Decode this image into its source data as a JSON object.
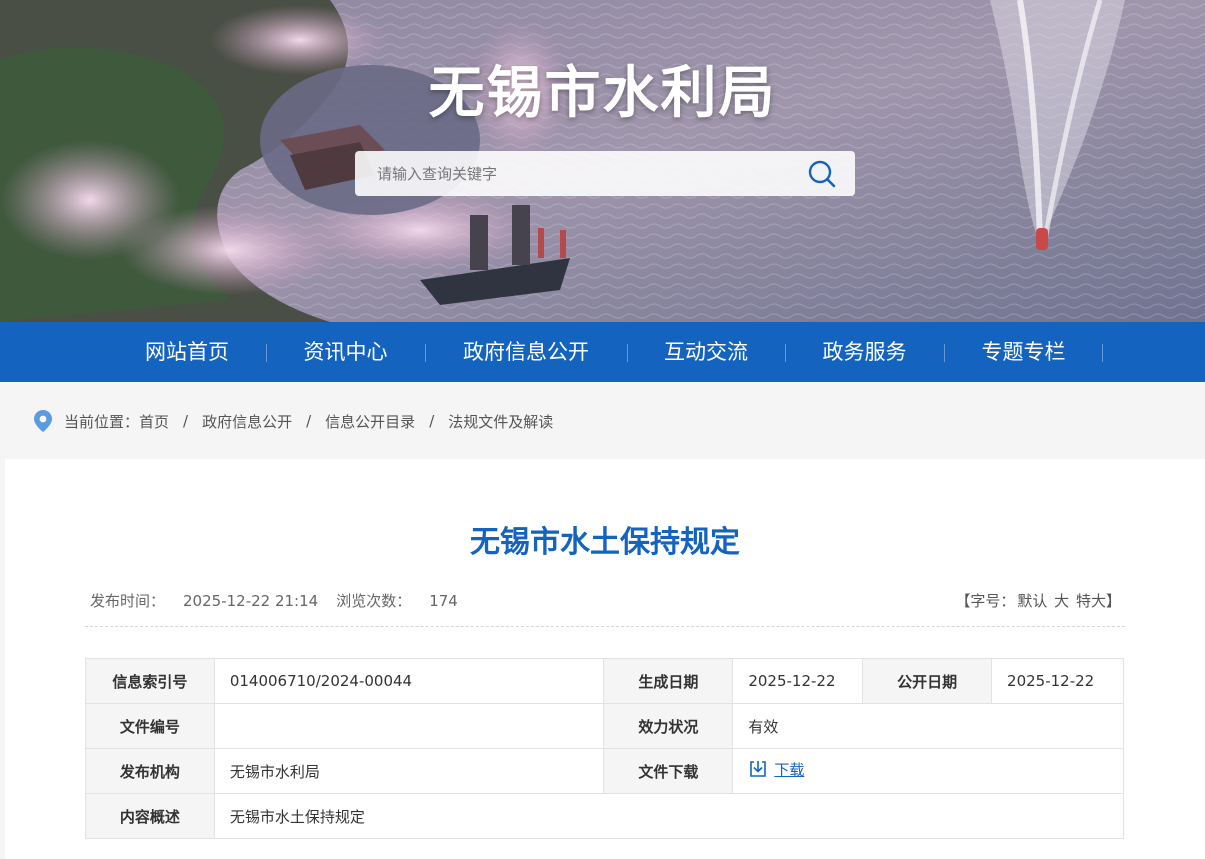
{
  "header": {
    "site_title": "无锡市水利局",
    "search_placeholder": "请输入查询关键字"
  },
  "nav": {
    "items": [
      "网站首页",
      "资讯中心",
      "政府信息公开",
      "互动交流",
      "政务服务",
      "专题专栏"
    ]
  },
  "breadcrumb": {
    "prefix": "当前位置：",
    "items": [
      "首页",
      "政府信息公开",
      "信息公开目录",
      "法规文件及解读"
    ],
    "separator": "/"
  },
  "article": {
    "title": "无锡市水土保持规定",
    "publish_label": "发布时间：",
    "publish_time": "2025-12-22 21:14",
    "views_label": "浏览次数：",
    "views": "174",
    "font_size": {
      "open": "【",
      "label": "字号：",
      "default": "默认",
      "large": "大",
      "xlarge": "特大",
      "close": "】"
    }
  },
  "info_table": {
    "index_no_label": "信息索引号",
    "index_no": "014006710/2024-00044",
    "created_label": "生成日期",
    "created": "2025-12-22",
    "public_date_label": "公开日期",
    "public_date": "2025-12-22",
    "doc_no_label": "文件编号",
    "doc_no": "",
    "validity_label": "效力状况",
    "validity": "有效",
    "publisher_label": "发布机构",
    "publisher": "无锡市水利局",
    "download_label": "文件下载",
    "download_link": "下载",
    "summary_label": "内容概述",
    "summary": "无锡市水土保持规定"
  },
  "colors": {
    "brand_blue": "#1464bf",
    "title_blue": "#1464bf"
  }
}
